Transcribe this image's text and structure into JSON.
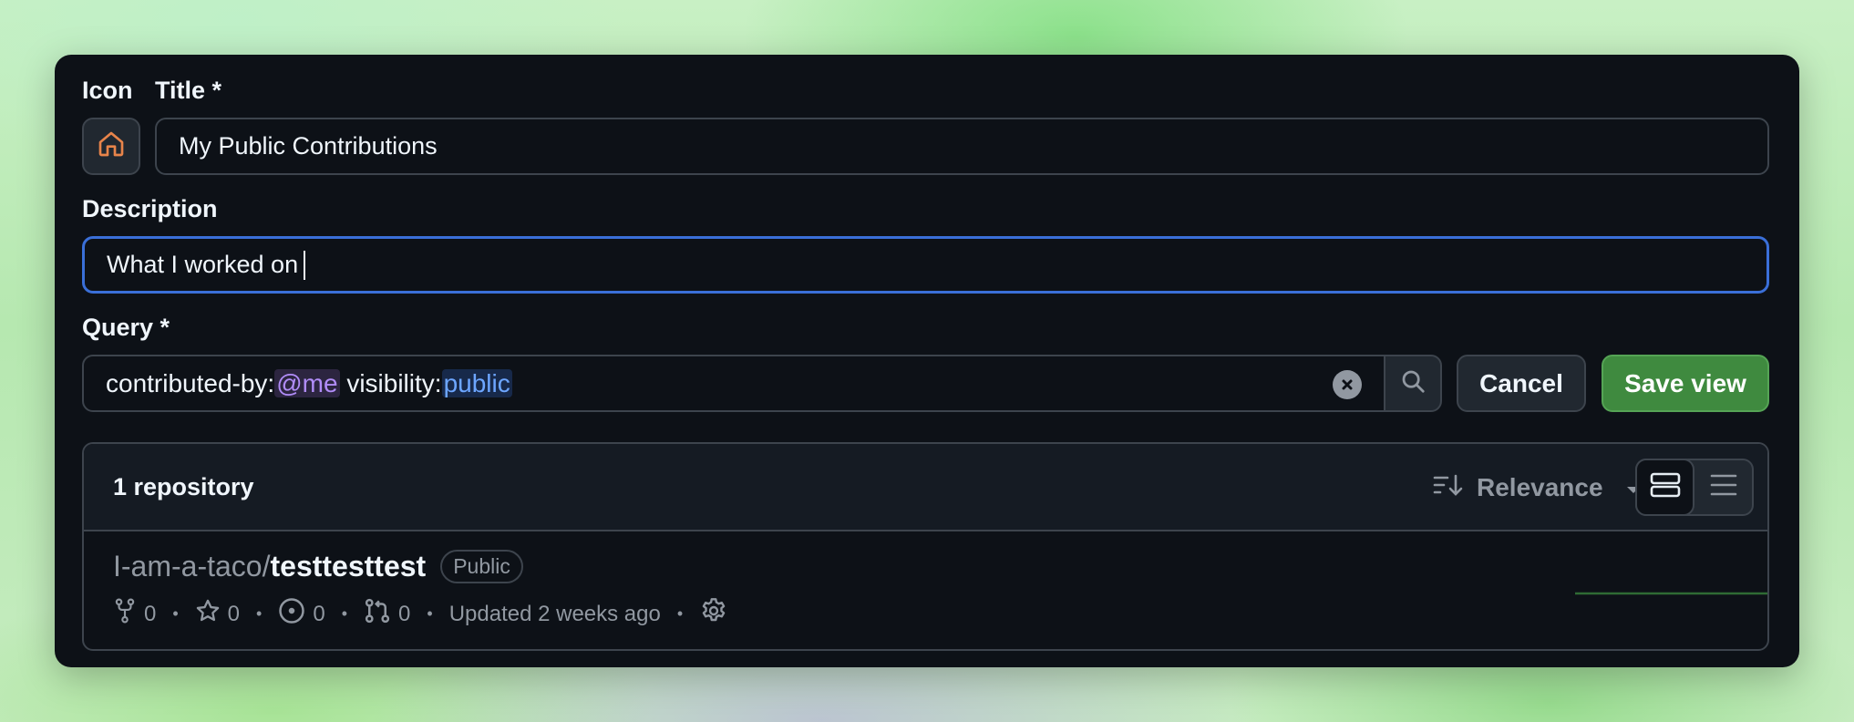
{
  "form": {
    "icon_label": "Icon",
    "title_label": "Title *",
    "title_value": "My Public Contributions",
    "description_label": "Description",
    "description_value": "What I worked on",
    "query_label": "Query *",
    "query_parts": {
      "p1": "contributed-by:",
      "p2": "@me",
      "p3": " visibility:",
      "p4": "public"
    },
    "cancel_label": "Cancel",
    "save_label": "Save view"
  },
  "results": {
    "count_label": "1 repository",
    "sort_label": "Relevance",
    "repo": {
      "owner": "I-am-a-taco/",
      "name": "testtesttest",
      "visibility": "Public",
      "forks": "0",
      "stars": "0",
      "issues": "0",
      "pulls": "0",
      "updated": "Updated 2 weeks ago"
    }
  },
  "colors": {
    "accent_focus": "#3a6fd8",
    "save_green": "#3f8a3f",
    "token_me": "#b08cf7",
    "token_public": "#6da6ff",
    "home_icon": "#e8844a"
  },
  "icons": [
    "home-icon",
    "clear-icon",
    "search-icon",
    "sort-icon",
    "chevron-down-icon",
    "card-view-icon",
    "list-view-icon",
    "fork-icon",
    "star-icon",
    "issue-icon",
    "pull-request-icon",
    "gear-icon"
  ]
}
